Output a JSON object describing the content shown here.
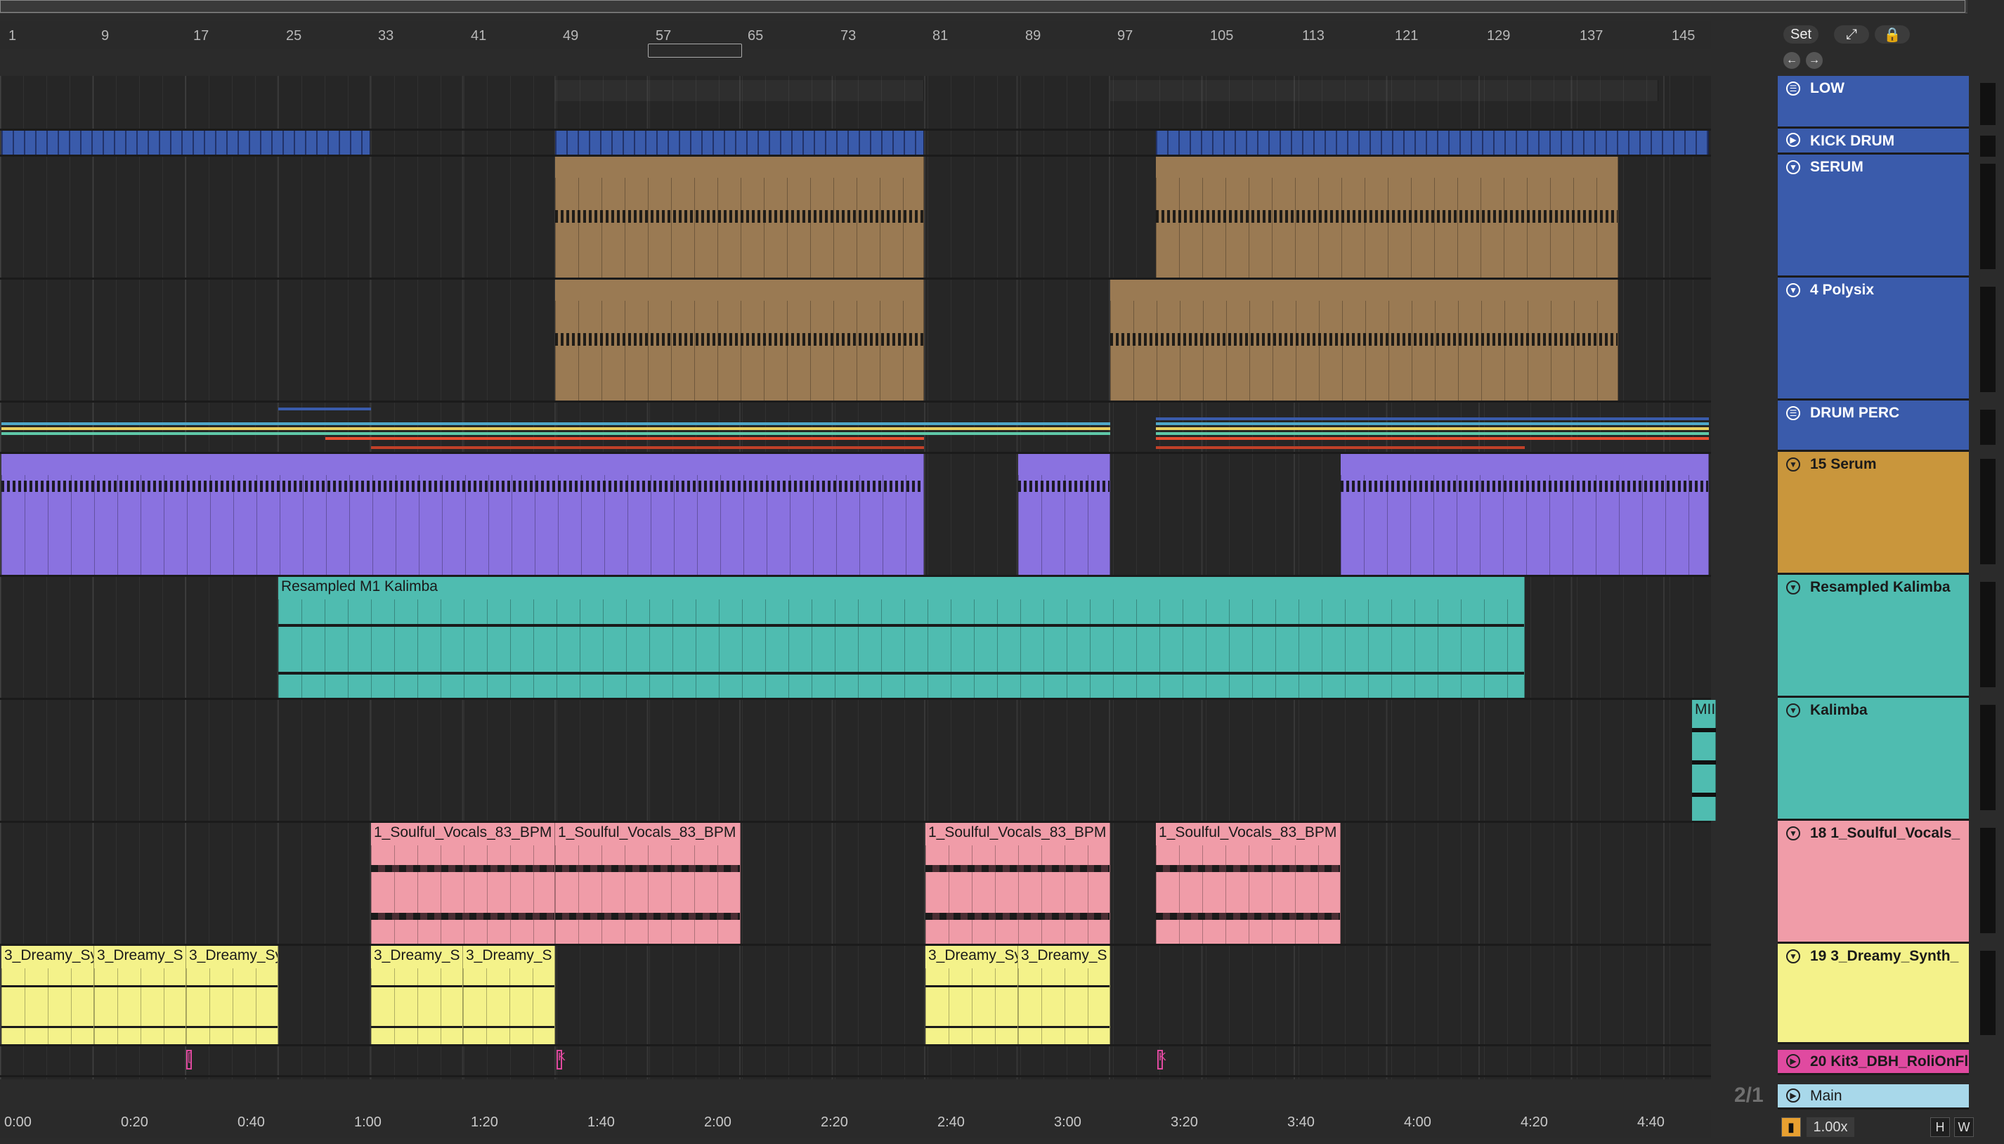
{
  "colors": {
    "background": "#262626",
    "blue_group": "#3a5bab",
    "tan_midi": "#9a7a53",
    "purple_midi": "#8a72e0",
    "teal_audio": "#4fbcb0",
    "pink_audio": "#f09ca8",
    "yellow_audio": "#f4f28a",
    "magenta_track": "#e04aa0",
    "main_track": "#a8d8ea",
    "gold_header": "#c9963c"
  },
  "bar_ruler": [
    "1",
    "9",
    "17",
    "25",
    "33",
    "41",
    "49",
    "57",
    "65",
    "73",
    "81",
    "89",
    "97",
    "105",
    "113",
    "121",
    "129",
    "137",
    "145"
  ],
  "time_ruler": [
    "0:00",
    "0:20",
    "0:40",
    "1:00",
    "1:20",
    "1:40",
    "2:00",
    "2:20",
    "2:40",
    "3:00",
    "3:20",
    "3:40",
    "4:00",
    "4:20",
    "4:40"
  ],
  "top_controls": {
    "set_label": "Set",
    "expand_icon": "expand-icon",
    "lock_icon": "lock-icon",
    "back_icon": "arrow-left-icon",
    "forward_icon": "arrow-right-icon"
  },
  "tracks": [
    {
      "name": "LOW",
      "kind": "group",
      "color": "#3a5bab"
    },
    {
      "name": "KICK DRUM",
      "kind": "audio",
      "color": "#3a5bab"
    },
    {
      "name": "SERUM",
      "kind": "midi",
      "color": "#3a5bab"
    },
    {
      "name": "4 Polysix",
      "kind": "midi",
      "color": "#3a5bab"
    },
    {
      "name": "DRUM PERC",
      "kind": "group",
      "color": "#3a5bab"
    },
    {
      "name": "15 Serum",
      "kind": "midi",
      "color": "#c9963c"
    },
    {
      "name": "Resampled Kalimba",
      "kind": "audio",
      "color": "#4fbcb0"
    },
    {
      "name": "Kalimba",
      "kind": "midi",
      "color": "#4fbcb0"
    },
    {
      "name": "18 1_Soulful_Vocals_",
      "kind": "audio",
      "color": "#f09ca8"
    },
    {
      "name": "19 3_Dreamy_Synth_",
      "kind": "audio",
      "color": "#f4f28a"
    },
    {
      "name": "20 Kit3_DBH_RoliOnFl",
      "kind": "midi",
      "color": "#e04aa0"
    },
    {
      "name": "Main",
      "kind": "main",
      "color": "#a8d8ea"
    }
  ],
  "clips": {
    "resampled_kalimba": "Resampled M1 Kalimba",
    "kalimba_midi": "MII",
    "vocals": [
      "1_Soulful_Vocals_83_BPM",
      "1_Soulful_Vocals_83_BPM",
      "1_Soulful_Vocals_83_BPM",
      "1_Soulful_Vocals_83_BPM"
    ],
    "synth": [
      "3_Dreamy_Sy",
      "3_Dreamy_S",
      "3_Dreamy_Sy",
      "3_Dreamy_S",
      "3_Dreamy_S",
      "3_Dreamy_Sy",
      "3_Dreamy_S"
    ],
    "kit_markers": [
      "[",
      "K",
      "K"
    ]
  },
  "page_indicator": "2/1",
  "bottom_controls": {
    "cpu_icon": "cpu-meter-icon",
    "zoom": "1.00x",
    "h_label": "H",
    "w_label": "W"
  }
}
